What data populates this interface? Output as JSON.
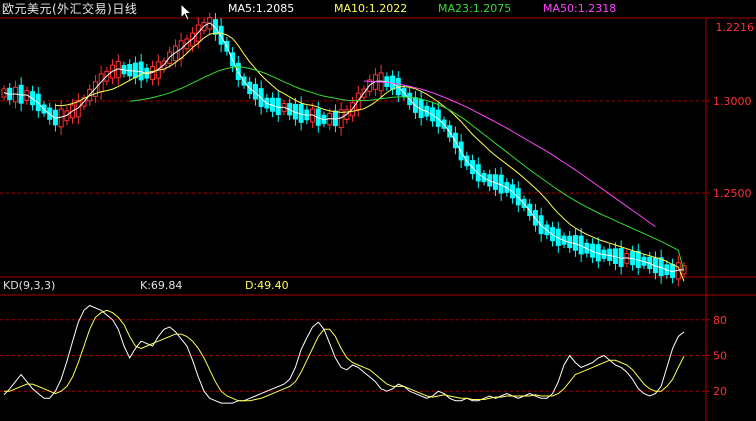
{
  "header": {
    "title": "欧元美元(外汇交易)日线",
    "ma5": "MA5:1.2085",
    "ma10": "MA10:1.2022",
    "ma23": "MA23:1.2075",
    "ma50": "MA50:1.2318"
  },
  "kd_header": {
    "indicator": "KD(9,3,3)",
    "k": "K:69.84",
    "d": "D:49.40"
  },
  "last_price_label": "1.2216",
  "colors": {
    "background": "#000000",
    "grid": "#aa0000",
    "axis_text": "#ff3030",
    "up_candle": "#ff3030",
    "down_candle": "#00ffff",
    "ma5": "#ffffff",
    "ma10": "#ffff55",
    "ma23": "#33dd33",
    "ma50": "#ff44ff",
    "k_line": "#ffffff",
    "d_line": "#ffff55"
  },
  "chart_data": [
    {
      "type": "candlestick",
      "title": "欧元美元(外汇交易)日线",
      "ylim": [
        1.205,
        1.345
      ],
      "yticks": [
        1.25,
        1.3
      ],
      "ytick_labels": [
        "1.2500",
        "1.3000"
      ],
      "grid": true,
      "series": [
        {
          "name": "MA5",
          "values": [
            1.3045,
            1.3035,
            1.3038,
            1.3032,
            1.3032,
            1.3012,
            1.2988,
            1.2954,
            1.2928,
            1.2906,
            1.2912,
            1.2922,
            1.2946,
            1.2962,
            1.2996,
            1.3034,
            1.3068,
            1.3102,
            1.3136,
            1.3162,
            1.3174,
            1.3168,
            1.3164,
            1.3162,
            1.3158,
            1.3148,
            1.3154,
            1.3172,
            1.3196,
            1.3238,
            1.3262,
            1.3282,
            1.3312,
            1.3336,
            1.3372,
            1.3406,
            1.3424,
            1.3398,
            1.3352,
            1.3294,
            1.3222,
            1.3156,
            1.3106,
            1.3068,
            1.3046,
            1.3014,
            1.2986,
            1.2976,
            1.2966,
            1.2966,
            1.2952,
            1.2938,
            1.2928,
            1.2922,
            1.2924,
            1.2908,
            1.2898,
            1.2904,
            1.2902,
            1.2908,
            1.2928,
            1.2958,
            1.3002,
            1.3044,
            1.3086,
            1.3106,
            1.3108,
            1.3102,
            1.3096,
            1.3074,
            1.3044,
            1.3008,
            1.2974,
            1.2954,
            1.2942,
            1.2924,
            1.2902,
            1.2872,
            1.2832,
            1.2782,
            1.2724,
            1.2672,
            1.2638,
            1.2606,
            1.2582,
            1.2566,
            1.2556,
            1.2544,
            1.2528,
            1.2506,
            1.2476,
            1.2442,
            1.2406,
            1.2362,
            1.2324,
            1.2298,
            1.2274,
            1.2256,
            1.2242,
            1.2232,
            1.2226,
            1.2214,
            1.2198,
            1.2184,
            1.2172,
            1.2166,
            1.2162,
            1.2154,
            1.2146,
            1.2148,
            1.2144,
            1.2136,
            1.2128,
            1.2118,
            1.2104,
            1.2096,
            1.2082,
            1.2074,
            1.2082,
            1.2085
          ]
        },
        {
          "name": "MA10",
          "values": [
            null,
            null,
            null,
            null,
            null,
            null,
            null,
            null,
            null,
            1.2976,
            1.2974,
            1.2978,
            1.2986,
            1.2996,
            1.3014,
            1.3028,
            1.304,
            1.305,
            1.3056,
            1.3064,
            1.3078,
            1.3094,
            1.3112,
            1.3128,
            1.3144,
            1.3154,
            1.316,
            1.3166,
            1.3172,
            1.3188,
            1.3208,
            1.3232,
            1.3258,
            1.329,
            1.3314,
            1.3342,
            1.3362,
            1.3368,
            1.3368,
            1.3358,
            1.3338,
            1.33,
            1.3254,
            1.3212,
            1.3176,
            1.314,
            1.311,
            1.3082,
            1.3056,
            1.304,
            1.3022,
            1.3004,
            1.2988,
            1.298,
            1.2976,
            1.2966,
            1.2954,
            1.2946,
            1.2942,
            1.2938,
            1.294,
            1.2944,
            1.295,
            1.2958,
            1.2974,
            1.2994,
            1.302,
            1.3046,
            1.3064,
            1.3076,
            1.3078,
            1.3074,
            1.3066,
            1.3052,
            1.3036,
            1.3016,
            1.2994,
            1.297,
            1.2948,
            1.2918,
            1.2888,
            1.2852,
            1.2818,
            1.2788,
            1.276,
            1.273,
            1.2704,
            1.268,
            1.2656,
            1.2632,
            1.2608,
            1.2582,
            1.2554,
            1.2526,
            1.2496,
            1.2462,
            1.2424,
            1.239,
            1.236,
            1.2332,
            1.231,
            1.2292,
            1.2276,
            1.2262,
            1.2248,
            1.2238,
            1.2228,
            1.2218,
            1.2208,
            1.2198,
            1.2188,
            1.2178,
            1.2168,
            1.216,
            1.215,
            1.2142,
            1.2128,
            1.2112,
            1.2098,
            1.2022
          ]
        },
        {
          "name": "MA23",
          "values": [
            null,
            null,
            null,
            null,
            null,
            null,
            null,
            null,
            null,
            null,
            null,
            null,
            null,
            null,
            null,
            null,
            null,
            null,
            null,
            null,
            null,
            null,
            1.2998,
            1.3002,
            1.3006,
            1.3012,
            1.3018,
            1.3026,
            1.3034,
            1.3044,
            1.3056,
            1.3068,
            1.3082,
            1.3098,
            1.3112,
            1.3128,
            1.3142,
            1.3156,
            1.3168,
            1.3176,
            1.3182,
            1.3184,
            1.3182,
            1.3176,
            1.3168,
            1.3158,
            1.3146,
            1.3132,
            1.3118,
            1.3104,
            1.309,
            1.3076,
            1.3064,
            1.3054,
            1.3044,
            1.3034,
            1.3026,
            1.302,
            1.3014,
            1.3008,
            1.3004,
            1.3002,
            1.3002,
            1.3002,
            1.3004,
            1.3008,
            1.3012,
            1.3016,
            1.302,
            1.3022,
            1.3022,
            1.302,
            1.3016,
            1.301,
            1.3002,
            1.2992,
            1.298,
            1.2966,
            1.295,
            1.2932,
            1.2912,
            1.289,
            1.2866,
            1.2842,
            1.2818,
            1.2794,
            1.277,
            1.2746,
            1.2722,
            1.2698,
            1.2674,
            1.265,
            1.2626,
            1.2604,
            1.2582,
            1.256,
            1.2538,
            1.2516,
            1.2496,
            1.2476,
            1.2458,
            1.244,
            1.2424,
            1.2408,
            1.2392,
            1.2378,
            1.2364,
            1.235,
            1.2336,
            1.2322,
            1.2308,
            1.2294,
            1.228,
            1.2266,
            1.2252,
            1.2238,
            1.2222,
            1.2206,
            1.219,
            1.2075
          ]
        },
        {
          "name": "MA50",
          "values": [
            null,
            null,
            null,
            null,
            null,
            null,
            null,
            null,
            null,
            null,
            null,
            null,
            null,
            null,
            null,
            null,
            null,
            null,
            null,
            null,
            null,
            null,
            null,
            null,
            null,
            null,
            null,
            null,
            null,
            null,
            null,
            null,
            null,
            null,
            null,
            null,
            null,
            null,
            null,
            null,
            null,
            null,
            null,
            null,
            null,
            null,
            null,
            null,
            null,
            null,
            null,
            null,
            null,
            null,
            null,
            null,
            null,
            null,
            null,
            null,
            null,
            null,
            null,
            1.3108,
            1.3106,
            1.3104,
            1.3102,
            1.31,
            1.3096,
            1.3092,
            1.3086,
            1.308,
            1.3072,
            1.3064,
            1.3054,
            1.3044,
            1.3032,
            1.302,
            1.3008,
            1.2994,
            1.298,
            1.2966,
            1.295,
            1.2934,
            1.2918,
            1.2902,
            1.2886,
            1.287,
            1.2852,
            1.2834,
            1.2816,
            1.2798,
            1.278,
            1.2762,
            1.2744,
            1.2726,
            1.2706,
            1.2686,
            1.2666,
            1.2646,
            1.2626,
            1.2604,
            1.2582,
            1.256,
            1.2538,
            1.2516,
            1.2494,
            1.2472,
            1.245,
            1.2428,
            1.2406,
            1.2384,
            1.2362,
            1.234,
            1.2318
          ]
        }
      ]
    },
    {
      "type": "line",
      "title": "KD(9,3,3)",
      "ylim": [
        0,
        100
      ],
      "yticks": [
        20,
        50,
        80
      ],
      "ytick_labels": [
        "20",
        "50",
        "80"
      ],
      "grid": true,
      "series": [
        {
          "name": "K",
          "values": [
            17,
            22,
            28,
            34,
            28,
            22,
            18,
            14,
            14,
            20,
            30,
            45,
            62,
            78,
            88,
            92,
            90,
            88,
            84,
            80,
            72,
            58,
            48,
            56,
            62,
            60,
            58,
            66,
            72,
            74,
            70,
            64,
            58,
            46,
            32,
            20,
            14,
            12,
            10,
            10,
            10,
            12,
            12,
            14,
            16,
            18,
            20,
            22,
            24,
            26,
            30,
            40,
            55,
            65,
            74,
            78,
            72,
            60,
            48,
            40,
            38,
            42,
            40,
            36,
            32,
            28,
            22,
            20,
            22,
            26,
            24,
            20,
            18,
            16,
            14,
            16,
            20,
            18,
            14,
            12,
            12,
            14,
            12,
            12,
            14,
            16,
            14,
            16,
            18,
            16,
            14,
            16,
            18,
            16,
            14,
            14,
            18,
            28,
            42,
            50,
            44,
            40,
            42,
            44,
            48,
            50,
            46,
            42,
            40,
            36,
            30,
            22,
            18,
            16,
            18,
            24,
            40,
            56,
            66,
            69.84
          ]
        },
        {
          "name": "D",
          "values": [
            20,
            20,
            22,
            24,
            26,
            26,
            24,
            22,
            20,
            18,
            20,
            24,
            32,
            44,
            58,
            72,
            82,
            86,
            88,
            86,
            82,
            76,
            66,
            58,
            56,
            58,
            60,
            62,
            64,
            66,
            68,
            68,
            66,
            62,
            56,
            48,
            38,
            28,
            20,
            16,
            14,
            12,
            12,
            12,
            13,
            14,
            16,
            18,
            20,
            22,
            24,
            28,
            36,
            46,
            56,
            66,
            72,
            72,
            66,
            56,
            48,
            44,
            42,
            40,
            38,
            34,
            30,
            26,
            24,
            24,
            24,
            22,
            20,
            18,
            16,
            15,
            16,
            17,
            16,
            15,
            14,
            14,
            13,
            13,
            13,
            14,
            15,
            15,
            16,
            16,
            16,
            16,
            16,
            17,
            16,
            16,
            16,
            18,
            22,
            28,
            34,
            36,
            38,
            40,
            42,
            44,
            46,
            46,
            44,
            42,
            38,
            32,
            26,
            22,
            20,
            20,
            24,
            30,
            40,
            49.4
          ]
        }
      ]
    }
  ]
}
